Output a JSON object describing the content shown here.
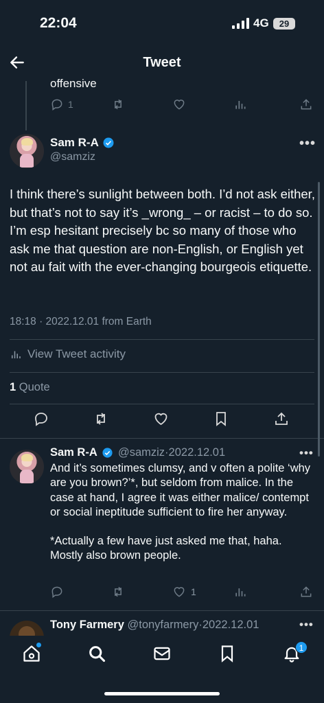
{
  "status": {
    "time": "22:04",
    "network": "4G",
    "battery": "29"
  },
  "header": {
    "title": "Tweet"
  },
  "parent": {
    "tail_text": "offensive",
    "replies": "1"
  },
  "main_tweet": {
    "name": "Sam R-A",
    "handle": "@samziz",
    "text": "I think there’s sunlight between both. I’d not ask either, but that’s not to say it’s _wrong_ – or racist – to do so. I’m esp hesitant precisely bc so many of those who ask me that question are non-English, or English yet not au fait with the ever-changing bourgeois etiquette.",
    "meta": "18:18 · 2022.12.01 from Earth",
    "activity_label": "View Tweet activity",
    "quote_count": "1",
    "quote_label": "Quote"
  },
  "reply": {
    "name": "Sam R-A",
    "handle": "@samziz",
    "date": "2022.12.01",
    "text_1": "And it’s sometimes clumsy, and v often a polite ‘why are you brown?’*, but seldom from malice. In the case at hand, I agree it was either malice/ contempt or social ineptitude sufficient to fire her anyway.",
    "text_2": "*Actually a few have just asked me that, haha. Mostly also brown people.",
    "likes": "1"
  },
  "third": {
    "name": "Tony Farmery",
    "handle": "@tonyfarmery",
    "date": "2022.12.01"
  },
  "nav": {
    "notifications_badge": "1"
  },
  "colors": {
    "background": "#15202b",
    "accent": "#1d9bf0",
    "muted": "#8b98a5"
  }
}
